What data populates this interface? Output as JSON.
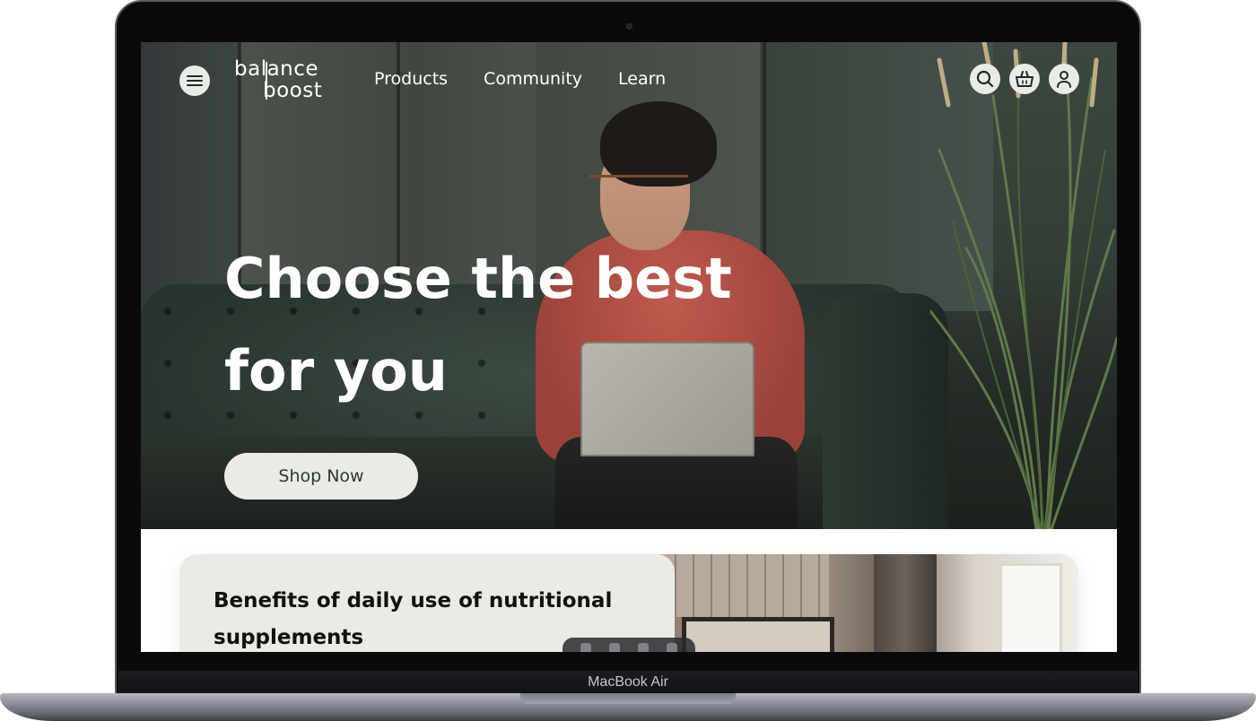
{
  "device": {
    "label": "MacBook Air"
  },
  "header": {
    "logo_line1": "balance",
    "logo_line2": "boost",
    "nav": [
      {
        "label": "Products"
      },
      {
        "label": "Community"
      },
      {
        "label": "Learn"
      }
    ]
  },
  "hero": {
    "headline_line1": "Choose the best",
    "headline_line2": "for you",
    "cta_label": "Shop Now"
  },
  "article": {
    "title": "Benefits of daily use of nutritional supplements"
  },
  "icons": [
    "menu-icon",
    "search-icon",
    "basket-icon",
    "user-icon"
  ],
  "colors": {
    "accent_pill": "#e9ece4",
    "cta_text": "#2b3a30"
  }
}
